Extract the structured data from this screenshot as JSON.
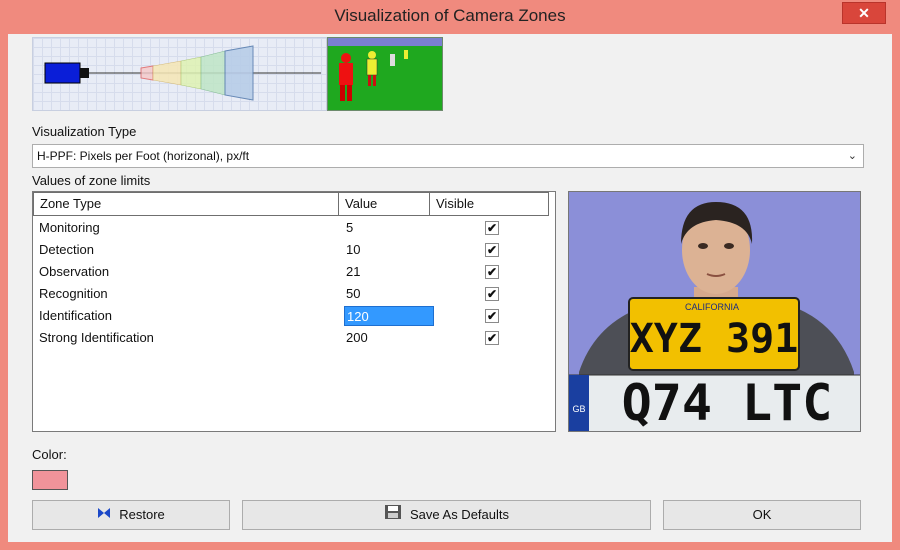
{
  "window": {
    "title": "Visualization of Camera Zones",
    "close_symbol": "✕"
  },
  "preview": {
    "camera_icon": "camera-icon"
  },
  "visualization_type": {
    "label": "Visualization Type",
    "selected": "H-PPF: Pixels per Foot (horizonal), px/ft"
  },
  "zone_limits": {
    "label": "Values of zone limits",
    "columns": [
      "Zone Type",
      "Value",
      "Visible"
    ],
    "rows": [
      {
        "name": "Monitoring",
        "value": "5",
        "visible": true
      },
      {
        "name": "Detection",
        "value": "10",
        "visible": true
      },
      {
        "name": "Observation",
        "value": "21",
        "visible": true
      },
      {
        "name": "Recognition",
        "value": "50",
        "visible": true
      },
      {
        "name": "Identification",
        "value": "120",
        "visible": true,
        "selected": true
      },
      {
        "name": "Strong Identification",
        "value": "200",
        "visible": true
      }
    ]
  },
  "photo": {
    "plate_top_state": "CALIFORNIA",
    "plate_top_text": "XYZ 391",
    "plate_bottom_region": "GB",
    "plate_bottom_text": "Q74 LTC"
  },
  "color": {
    "label": "Color:",
    "value": "#f0939a"
  },
  "buttons": {
    "restore": "Restore",
    "save_defaults": "Save As Defaults",
    "ok": "OK"
  }
}
